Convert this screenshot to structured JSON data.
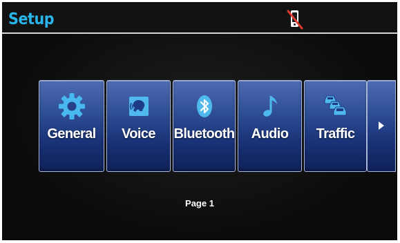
{
  "header": {
    "title": "Setup",
    "status_icon": "phone-disconnected-icon"
  },
  "menu": {
    "items": [
      {
        "label": "General",
        "icon": "gear-icon"
      },
      {
        "label": "Voice",
        "icon": "voice-icon"
      },
      {
        "label": "Bluetooth",
        "icon": "bluetooth-icon"
      },
      {
        "label": "Audio",
        "icon": "music-note-icon"
      },
      {
        "label": "Traffic",
        "icon": "traffic-cars-icon"
      }
    ],
    "next_icon": "chevron-right-icon"
  },
  "footer": {
    "page_label": "Page 1"
  },
  "colors": {
    "title": "#29b4ea",
    "tile_top": "#4e6bb2",
    "tile_bottom": "#0e2057",
    "icon_blue": "#3fb6ee"
  }
}
